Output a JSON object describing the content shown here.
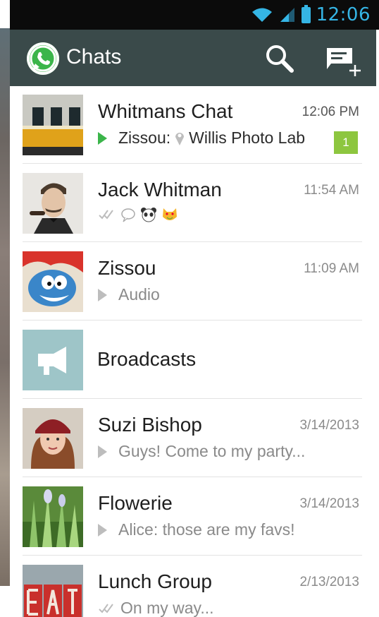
{
  "status": {
    "time": "12:06"
  },
  "action_bar": {
    "title": "Chats"
  },
  "chats": [
    {
      "name": "Whitmans Chat",
      "time": "12:06 PM",
      "sender": "Zissou:",
      "location": "Willis Photo Lab",
      "unread": "1"
    },
    {
      "name": "Jack Whitman",
      "time": "11:54 AM"
    },
    {
      "name": "Zissou",
      "time": "11:09 AM",
      "preview": "Audio"
    },
    {
      "name": "Broadcasts"
    },
    {
      "name": "Suzi Bishop",
      "time": "3/14/2013",
      "preview": "Guys! Come to my party..."
    },
    {
      "name": "Flowerie",
      "time": "3/14/2013",
      "preview": "Alice: those are my favs!"
    },
    {
      "name": "Lunch Group",
      "time": "2/13/2013",
      "preview": "On my way..."
    }
  ],
  "colors": {
    "accent": "#3bb54a",
    "status_blue": "#35b5e5",
    "action_bar": "#3a4a4a",
    "badge": "#8dc63f"
  }
}
